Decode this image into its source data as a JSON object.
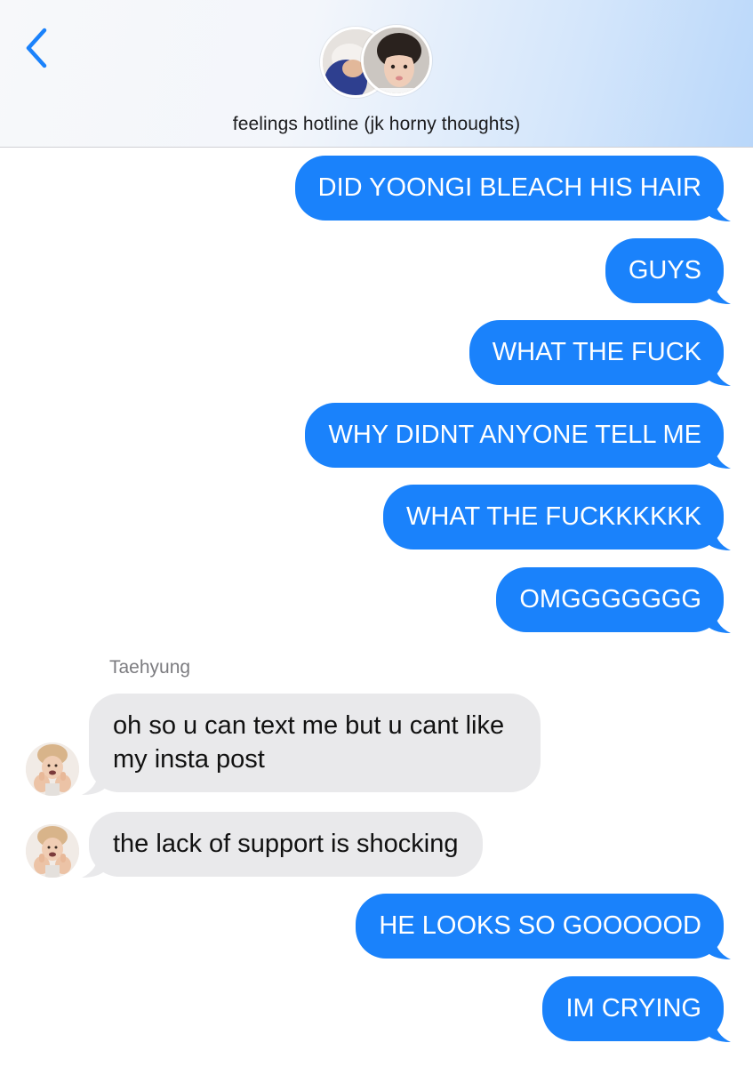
{
  "header": {
    "title": "feelings hotline (jk horny thoughts)",
    "accent": "#1a82fb"
  },
  "sender_name": "Taehyung",
  "messages": [
    {
      "dir": "out",
      "text": "DID YOONGI BLEACH HIS HAIR"
    },
    {
      "dir": "out",
      "text": "GUYS"
    },
    {
      "dir": "out",
      "text": "WHAT THE FUCK"
    },
    {
      "dir": "out",
      "text": "WHY DIDNT ANYONE TELL ME"
    },
    {
      "dir": "out",
      "text": "WHAT THE FUCKKKKKK"
    },
    {
      "dir": "out",
      "text": "OMGGGGGGG"
    },
    {
      "dir": "in",
      "text": "oh so u can text me but u cant like my insta post"
    },
    {
      "dir": "in",
      "text": "the lack of support is shocking"
    },
    {
      "dir": "out",
      "text": "HE LOOKS SO GOOOOOD"
    },
    {
      "dir": "out",
      "text": "IM CRYING"
    }
  ],
  "colors": {
    "outgoing_bubble": "#1a82fb",
    "incoming_bubble": "#e9e9eb",
    "sender_name": "#7c7c80"
  }
}
